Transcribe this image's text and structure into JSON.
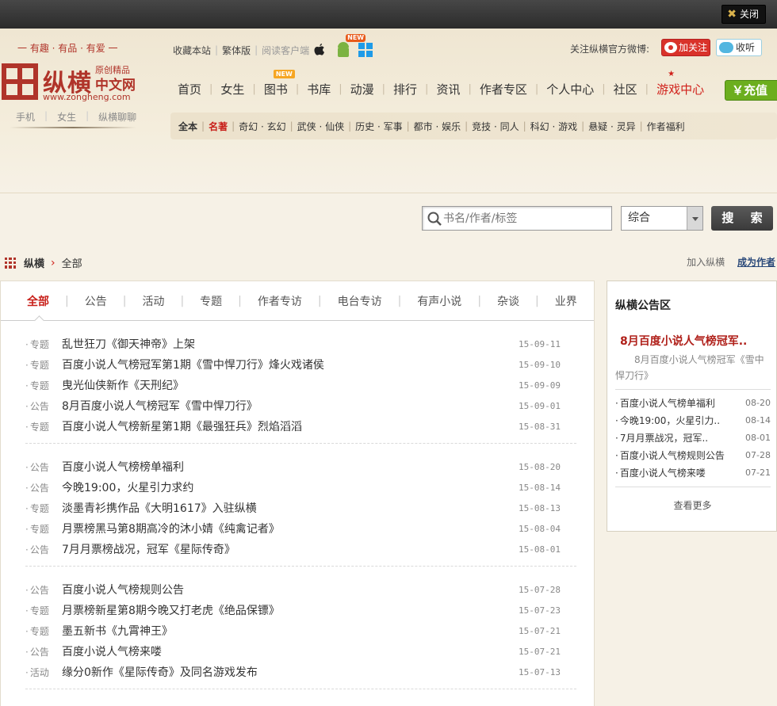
{
  "topbar": {
    "close_label": "关闭"
  },
  "header": {
    "slogan": "一 有趣 · 有品 · 有爱 一",
    "logo": {
      "name": "纵横",
      "sub1": "原创精品",
      "sub2": "中文网",
      "url": "www.zongheng.com"
    },
    "logo_links": [
      "手机",
      "女生",
      "纵横聊聊"
    ],
    "toplinks": {
      "bookmark": "收藏本站",
      "traditional": "繁体版",
      "client": "阅读客户端",
      "new_tag": "NEW"
    },
    "weibo": {
      "label": "关注纵横官方微博:",
      "follow": "加关注",
      "listen": "收听"
    },
    "mainnav": [
      {
        "label": "首页"
      },
      {
        "label": "女生"
      },
      {
        "label": "图书",
        "badge": "NEW"
      },
      {
        "label": "书库"
      },
      {
        "label": "动漫"
      },
      {
        "label": "排行"
      },
      {
        "label": "资讯"
      },
      {
        "label": "作者专区"
      },
      {
        "label": "个人中心"
      },
      {
        "label": "社区"
      },
      {
        "label": "游戏中心"
      }
    ],
    "recharge": "￥充值",
    "subnav": [
      "全本",
      "名著",
      "奇幻 · 玄幻",
      "武侠 · 仙侠",
      "历史 · 军事",
      "都市 · 娱乐",
      "竞技 · 同人",
      "科幻 · 游戏",
      "悬疑 · 灵异",
      "作者福利"
    ]
  },
  "search": {
    "placeholder": "书名/作者/标签",
    "select_value": "综合",
    "button": "搜 索"
  },
  "breadcrumb": {
    "home": "纵横",
    "current": "全部",
    "join": "加入纵横",
    "become_author": "成为作者"
  },
  "tabs": [
    "全部",
    "公告",
    "活动",
    "专题",
    "作者专访",
    "电台专访",
    "有声小说",
    "杂谈",
    "业界"
  ],
  "news_groups": [
    [
      {
        "cat": "专题",
        "title": "乱世狂刀《御天神帝》上架",
        "date": "15-09-11"
      },
      {
        "cat": "专题",
        "title": "百度小说人气榜冠军第1期《雪中悍刀行》烽火戏诸侯",
        "date": "15-09-10"
      },
      {
        "cat": "专题",
        "title": "曳光仙侠新作《天刑纪》",
        "date": "15-09-09"
      },
      {
        "cat": "公告",
        "title": "8月百度小说人气榜冠军《雪中悍刀行》",
        "date": "15-09-01"
      },
      {
        "cat": "专题",
        "title": "百度小说人气榜新星第1期《最强狂兵》烈焰滔滔",
        "date": "15-08-31"
      }
    ],
    [
      {
        "cat": "公告",
        "title": "百度小说人气榜榜单福利",
        "date": "15-08-20"
      },
      {
        "cat": "公告",
        "title": "今晚19:00，火星引力求约",
        "date": "15-08-14"
      },
      {
        "cat": "专题",
        "title": "淡墨青衫携作品《大明1617》入驻纵横",
        "date": "15-08-13"
      },
      {
        "cat": "专题",
        "title": "月票榜黑马第8期高冷的沐小婧《纯禽记者》",
        "date": "15-08-04"
      },
      {
        "cat": "公告",
        "title": "7月月票榜战况，冠军《星际传奇》",
        "date": "15-08-01"
      }
    ],
    [
      {
        "cat": "公告",
        "title": "百度小说人气榜规则公告",
        "date": "15-07-28"
      },
      {
        "cat": "专题",
        "title": "月票榜新星第8期今晚又打老虎《绝品保镖》",
        "date": "15-07-23"
      },
      {
        "cat": "专题",
        "title": "墨五新书《九霄神王》",
        "date": "15-07-21"
      },
      {
        "cat": "公告",
        "title": "百度小说人气榜来喽",
        "date": "15-07-21"
      },
      {
        "cat": "活动",
        "title": "缘分0新作《星际传奇》及同名游戏发布",
        "date": "15-07-13"
      }
    ]
  ],
  "side": {
    "title": "纵横公告区",
    "headline": "8月百度小说人气榜冠军..",
    "summary": "8月百度小说人气榜冠军《雪中悍刀行》",
    "items": [
      {
        "title": "百度小说人气榜单福利",
        "date": "08-20"
      },
      {
        "title": "今晚19:00，火星引力..",
        "date": "08-14"
      },
      {
        "title": "7月月票战况，冠军..",
        "date": "08-01"
      },
      {
        "title": "百度小说人气榜规则公告",
        "date": "07-28"
      },
      {
        "title": "百度小说人气榜来喽",
        "date": "07-21"
      }
    ],
    "more": "查看更多"
  },
  "colors": {
    "brand_red": "#b0342a",
    "accent_red": "#c8201a",
    "recharge_green": "#6cae1e",
    "background": "#f6f1e6"
  },
  "icons": [
    "close-icon",
    "apple-icon",
    "android-icon",
    "windows-icon",
    "weibo-icon",
    "qq-icon",
    "search-icon",
    "chevron-down-icon",
    "grid-icon",
    "chevron-right-icon"
  ]
}
